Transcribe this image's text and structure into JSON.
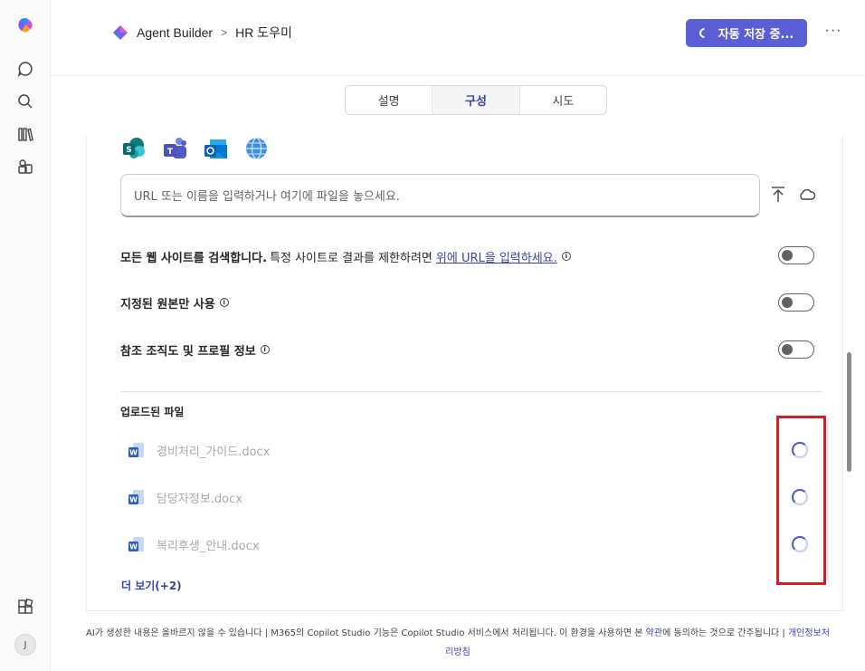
{
  "header": {
    "breadcrumb_root": "Agent Builder",
    "breadcrumb_current": "HR 도우미",
    "save_label": "자동 저장 중...",
    "more_label": "···"
  },
  "tabs": [
    {
      "label": "설명"
    },
    {
      "label": "구성",
      "active": true
    },
    {
      "label": "시도"
    }
  ],
  "knowledge": {
    "source_icons": [
      "sharepoint-icon",
      "teams-icon",
      "outlook-icon",
      "globe-icon"
    ],
    "url_placeholder": "URL 또는 이름을 입력하거나 여기에 파일을 놓으세요.",
    "options": [
      {
        "bold": "모든 웹 사이트를 검색합니다.",
        "text": "특정 사이트로 결과를 제한하려면",
        "link": "위에 URL을 입력하세요.",
        "toggle_on": false
      },
      {
        "bold": "지정된 원본만 사용",
        "toggle_on": false
      },
      {
        "bold": "참조 조직도 및 프로필 정보",
        "toggle_on": false
      }
    ],
    "files_title": "업로드된 파일",
    "files": [
      {
        "name": "경비처리_가이드.docx",
        "status": "loading"
      },
      {
        "name": "담당자정보.docx",
        "status": "loading"
      },
      {
        "name": "복리후생_안내.docx",
        "status": "loading"
      }
    ],
    "show_more": "더 보기(+2)"
  },
  "footer": {
    "text1": "AI가 생성한 내용은 올바르지 않을 수 있습니다 | M365의 Copilot Studio 기능은 Copilot Studio 서비스에서 처리됩니다. 이 환경을 사용하면 본 ",
    "terms": "약관",
    "text2": "에 동의하는 것으로 간주됩니다 | ",
    "privacy1": "개인정보처",
    "privacy2": "리방침"
  },
  "user": {
    "initial": "J"
  },
  "colors": {
    "accent": "#5b5fd6",
    "link": "#3d3fa8",
    "highlight": "#d21f26"
  }
}
